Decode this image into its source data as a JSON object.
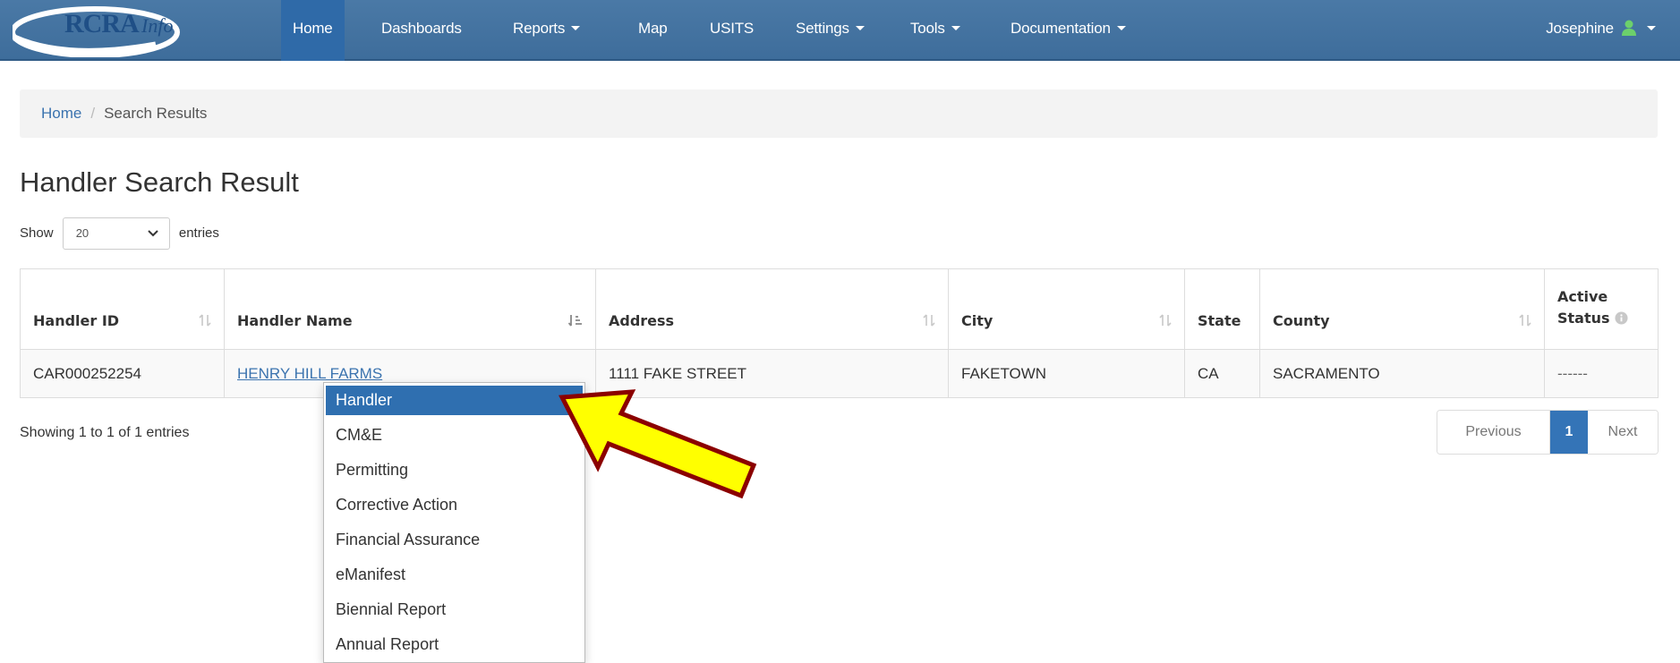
{
  "colors": {
    "navbar": "#3e6d9b",
    "nav_active": "#2f6aa8",
    "link": "#3b73af",
    "menu_active": "#2f6fb0",
    "pager_active": "#3474b7",
    "user_icon": "#6cd06c",
    "arrow_fill": "#ffff00",
    "arrow_stroke": "#8b0000"
  },
  "brand": {
    "logo_text": "RCRA",
    "logo_script": "Info"
  },
  "nav": {
    "items": [
      {
        "label": "Home",
        "has_caret": false,
        "active": true
      },
      {
        "label": "Dashboards",
        "has_caret": false
      },
      {
        "label": "Reports",
        "has_caret": true
      },
      {
        "label": "Map",
        "has_caret": false
      },
      {
        "label": "USITS",
        "has_caret": false
      },
      {
        "label": "Settings",
        "has_caret": true
      },
      {
        "label": "Tools",
        "has_caret": true
      },
      {
        "label": "Documentation",
        "has_caret": true
      }
    ],
    "user": "Josephine",
    "user_icon": "user-icon"
  },
  "breadcrumb": {
    "home": "Home",
    "current": "Search Results"
  },
  "page_title": "Handler Search Result",
  "entries": {
    "show": "Show",
    "value": "20",
    "suffix": "entries"
  },
  "table": {
    "headers": [
      "Handler ID",
      "Handler Name",
      "Address",
      "City",
      "State",
      "County",
      "Active",
      "Status"
    ],
    "rows": [
      {
        "handler_id": "CAR000252254",
        "handler_name": "HENRY HILL FARMS",
        "address": "1111 FAKE STREET",
        "city": "FAKETOWN",
        "state": "CA",
        "county": "SACRAMENTO",
        "active_status": "------"
      }
    ]
  },
  "info": "Showing 1 to 1 of 1 entries",
  "pager": {
    "previous": "Previous",
    "current": "1",
    "next": "Next"
  },
  "menu": {
    "items": [
      "Handler",
      "CM&E",
      "Permitting",
      "Corrective Action",
      "Financial Assurance",
      "eManifest",
      "Biennial Report",
      "Annual Report"
    ],
    "active_index": 0
  }
}
